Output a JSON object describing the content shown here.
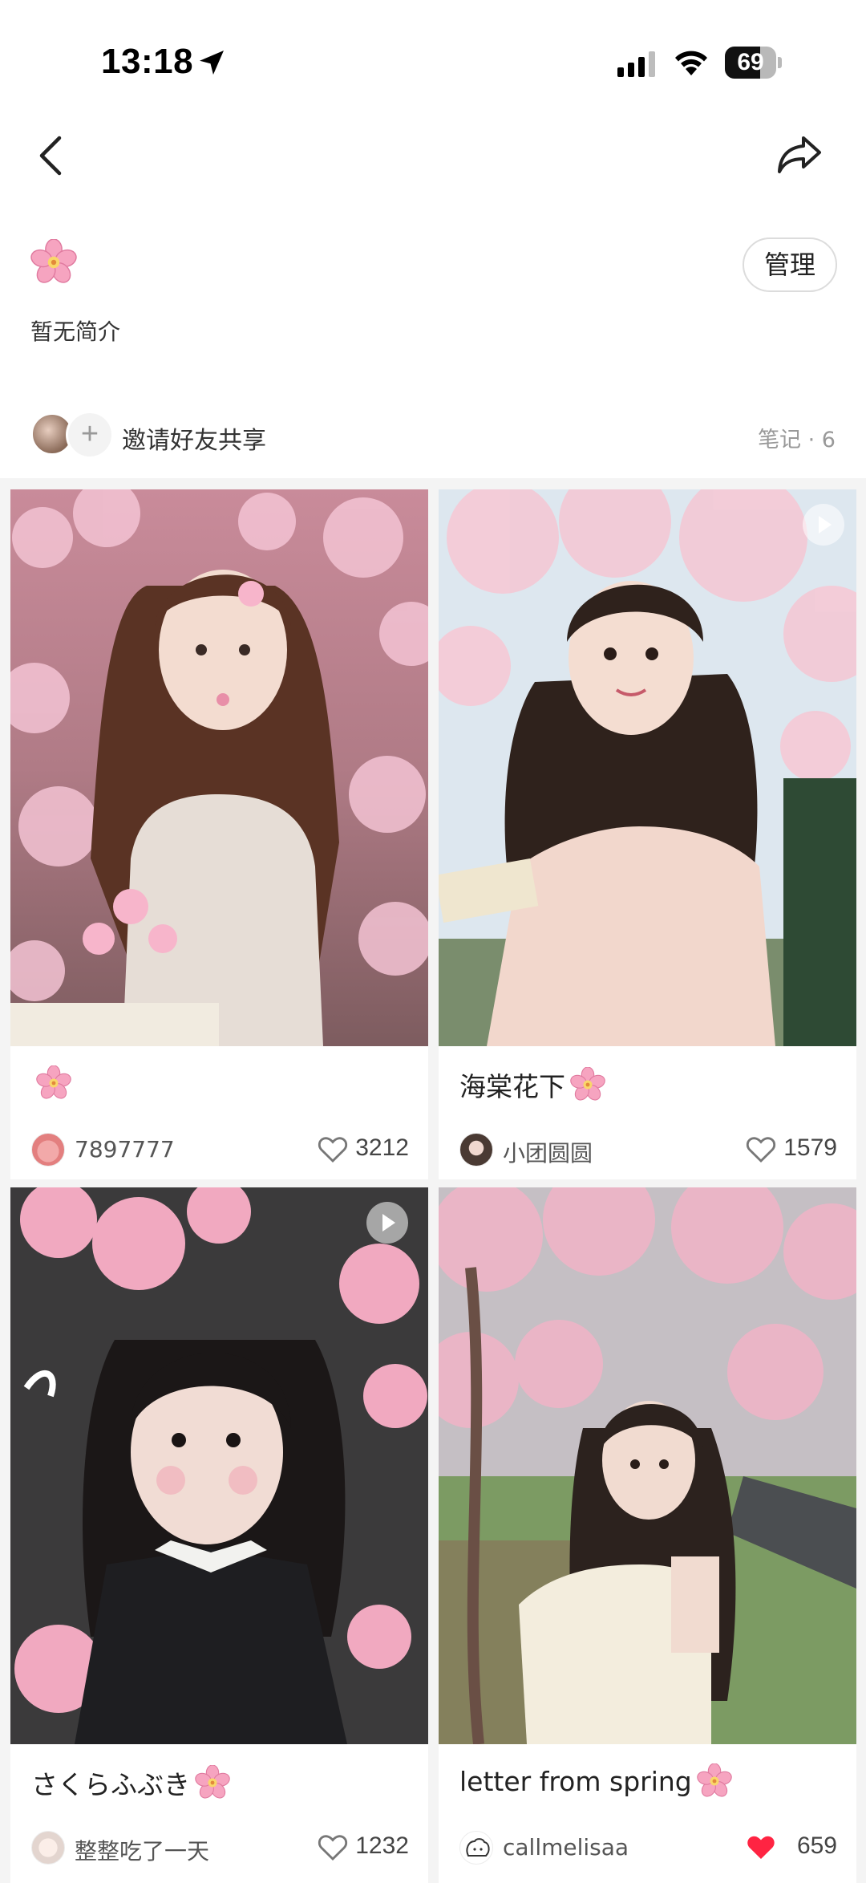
{
  "status_bar": {
    "time": "13:18",
    "battery_level": "69",
    "battery_fraction": 0.69,
    "icons": [
      "location-arrow-icon",
      "cellular-signal-icon",
      "wifi-icon",
      "battery-icon"
    ]
  },
  "nav": {
    "back_icon": "chevron-left-icon",
    "share_icon": "share-arrow-icon"
  },
  "board": {
    "emoji_icon": "cherry-blossom-icon",
    "manage_label": "管理",
    "intro": "暂无简介",
    "invite_label": "邀请好友共享",
    "note_count": "笔记 · 6"
  },
  "cards": [
    {
      "title": "",
      "author": "7897777",
      "likes": "3212",
      "liked": false,
      "has_video": false
    },
    {
      "title": "海棠花下",
      "author": "小团圆圆",
      "likes": "1579",
      "liked": false,
      "has_video": true
    },
    {
      "title": "さくらふぶき ",
      "author": "整整吃了一天",
      "likes": "1232",
      "liked": false,
      "has_video": true
    },
    {
      "title": "letter from spring",
      "author": "callmelisaa",
      "likes": "659",
      "liked": true,
      "has_video": false
    }
  ],
  "colors": {
    "like_active": "#ff2442",
    "like_inactive": "#777777",
    "blossom_pink": "#f7a8c4",
    "grid_background": "#f4f4f4"
  }
}
